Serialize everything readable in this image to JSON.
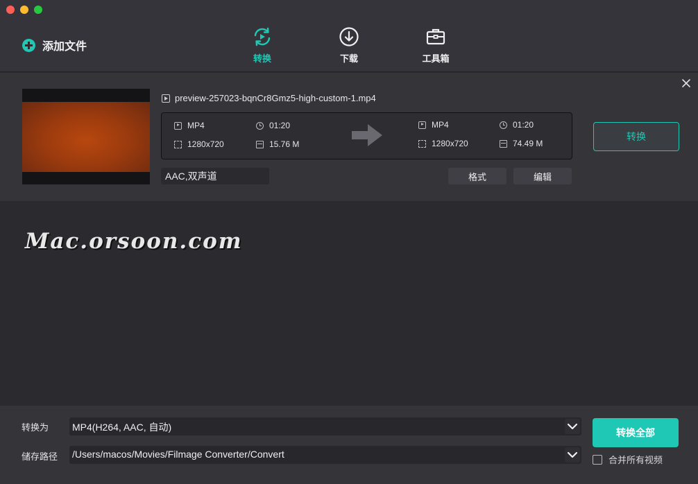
{
  "header": {
    "add_file_label": "添加文件",
    "tabs": [
      {
        "label": "转换",
        "icon": "convert-icon",
        "active": true
      },
      {
        "label": "下载",
        "icon": "download-icon",
        "active": false
      },
      {
        "label": "工具箱",
        "icon": "toolbox-icon",
        "active": false
      }
    ]
  },
  "file": {
    "name": "preview-257023-bqnCr8Gmz5-high-custom-1.mp4",
    "source": {
      "format": "MP4",
      "duration": "01:20",
      "resolution": "1280x720",
      "size": "15.76 M"
    },
    "target": {
      "format": "MP4",
      "duration": "01:20",
      "resolution": "1280x720",
      "size": "74.49 M"
    },
    "audio": "AAC,双声道",
    "format_button": "格式",
    "edit_button": "编辑",
    "convert_button": "转换"
  },
  "watermark": "Mac.orsoon.com",
  "bottom": {
    "convert_to_label": "转换为",
    "convert_to_value": "MP4(H264, AAC, 自动)",
    "save_path_label": "储存路径",
    "save_path_value": "/Users/macos/Movies/Filmage Converter/Convert",
    "convert_all_button": "转换全部",
    "merge_label": "合并所有视频",
    "merge_checked": false
  },
  "colors": {
    "accent": "#1fc8b4",
    "background": "#2b2a2f",
    "panel": "#353439"
  }
}
